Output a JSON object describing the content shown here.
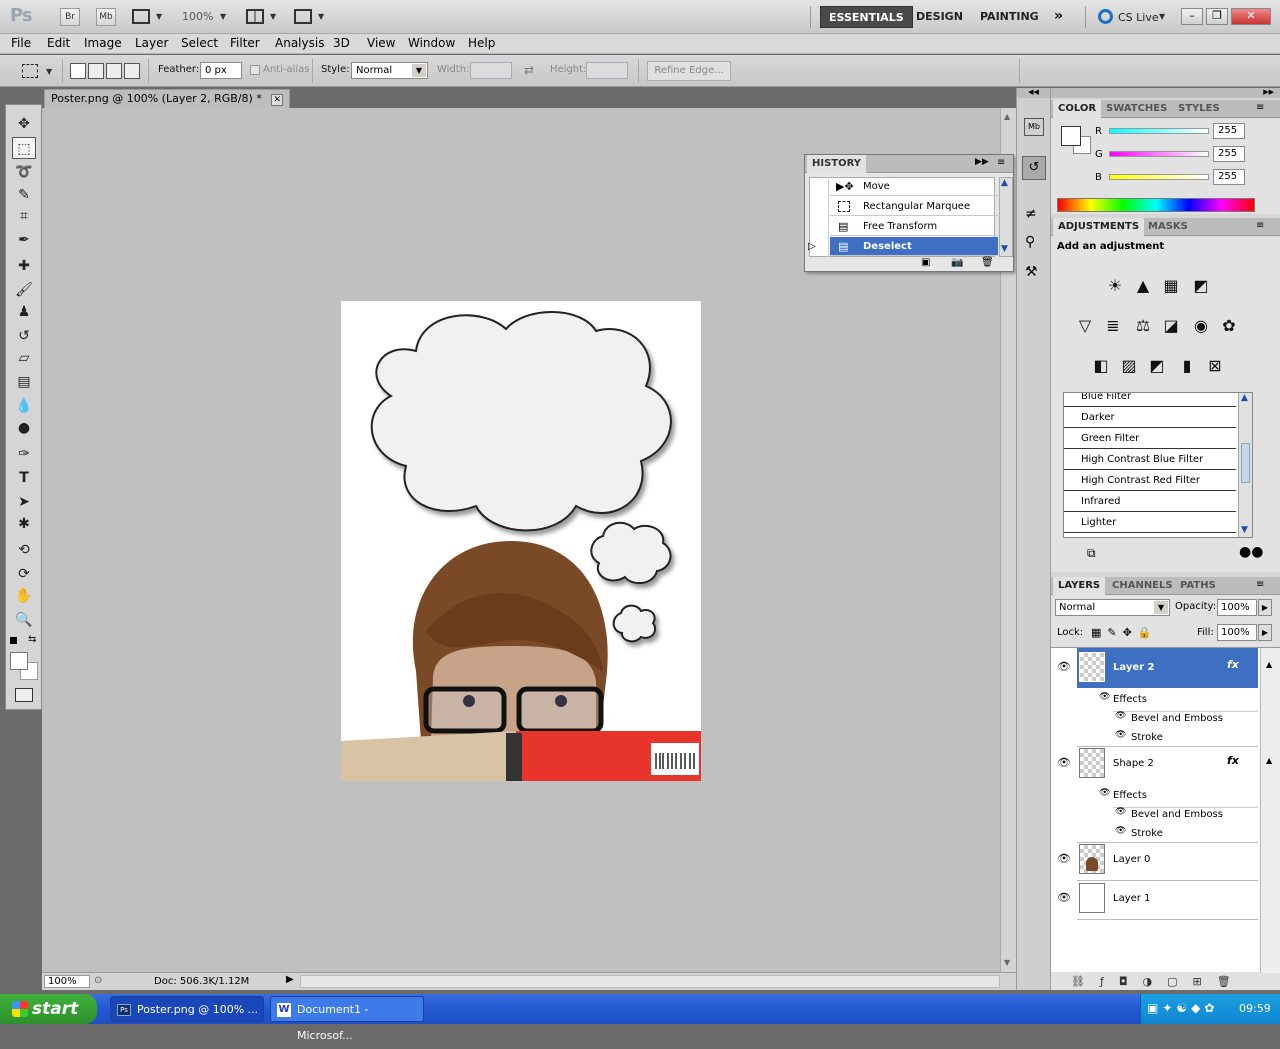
{
  "app": {
    "logo": "Ps",
    "bridge": "Br",
    "minibridge": "Mb",
    "zoom": "100%",
    "workspaces": [
      "ESSENTIALS",
      "DESIGN",
      "PAINTING"
    ],
    "cslive": "CS Live"
  },
  "menu": [
    "File",
    "Edit",
    "Image",
    "Layer",
    "Select",
    "Filter",
    "Analysis",
    "3D",
    "View",
    "Window",
    "Help"
  ],
  "options": {
    "feather_label": "Feather:",
    "feather_value": "0 px",
    "antialias": "Anti-alias",
    "style_label": "Style:",
    "style_value": "Normal",
    "width_label": "Width:",
    "height_label": "Height:",
    "refine": "Refine Edge..."
  },
  "document": {
    "tab_title": "Poster.png @ 100% (Layer 2, RGB/8) *",
    "zoom": "100%",
    "doc_info": "Doc: 506.3K/1.12M"
  },
  "history": {
    "title": "HISTORY",
    "items": [
      "Move",
      "Rectangular Marquee",
      "Free Transform",
      "Deselect"
    ],
    "selected": 3
  },
  "color": {
    "tabs": [
      "COLOR",
      "SWATCHES",
      "STYLES"
    ],
    "channels": [
      {
        "name": "R",
        "value": "255",
        "color": "#00ffff"
      },
      {
        "name": "G",
        "value": "255",
        "color": "#ff00ff"
      },
      {
        "name": "B",
        "value": "255",
        "color": "#ffff00"
      }
    ]
  },
  "adjustments": {
    "tabs": [
      "ADJUSTMENTS",
      "MASKS"
    ],
    "title": "Add an adjustment",
    "presets": [
      "Blue Filter",
      "Darker",
      "Green Filter",
      "High Contrast Blue Filter",
      "High Contrast Red Filter",
      "Infrared",
      "Lighter"
    ]
  },
  "layers_panel": {
    "tabs": [
      "LAYERS",
      "CHANNELS",
      "PATHS"
    ],
    "blend": "Normal",
    "opacity_label": "Opacity:",
    "opacity": "100%",
    "lock_label": "Lock:",
    "fill_label": "Fill:",
    "fill": "100%",
    "layers": [
      {
        "name": "Layer 2",
        "fx": "fx",
        "effects": "Effects",
        "effect_items": [
          "Bevel and Emboss",
          "Stroke"
        ]
      },
      {
        "name": "Shape 2",
        "fx": "fx",
        "effects": "Effects",
        "effect_items": [
          "Bevel and Emboss",
          "Stroke"
        ]
      },
      {
        "name": "Layer 0"
      },
      {
        "name": "Layer 1"
      }
    ]
  },
  "taskbar": {
    "start": "start",
    "tasks": [
      "Poster.png @ 100% ...",
      "Document1 - Microsof..."
    ],
    "clock": "09:59"
  }
}
